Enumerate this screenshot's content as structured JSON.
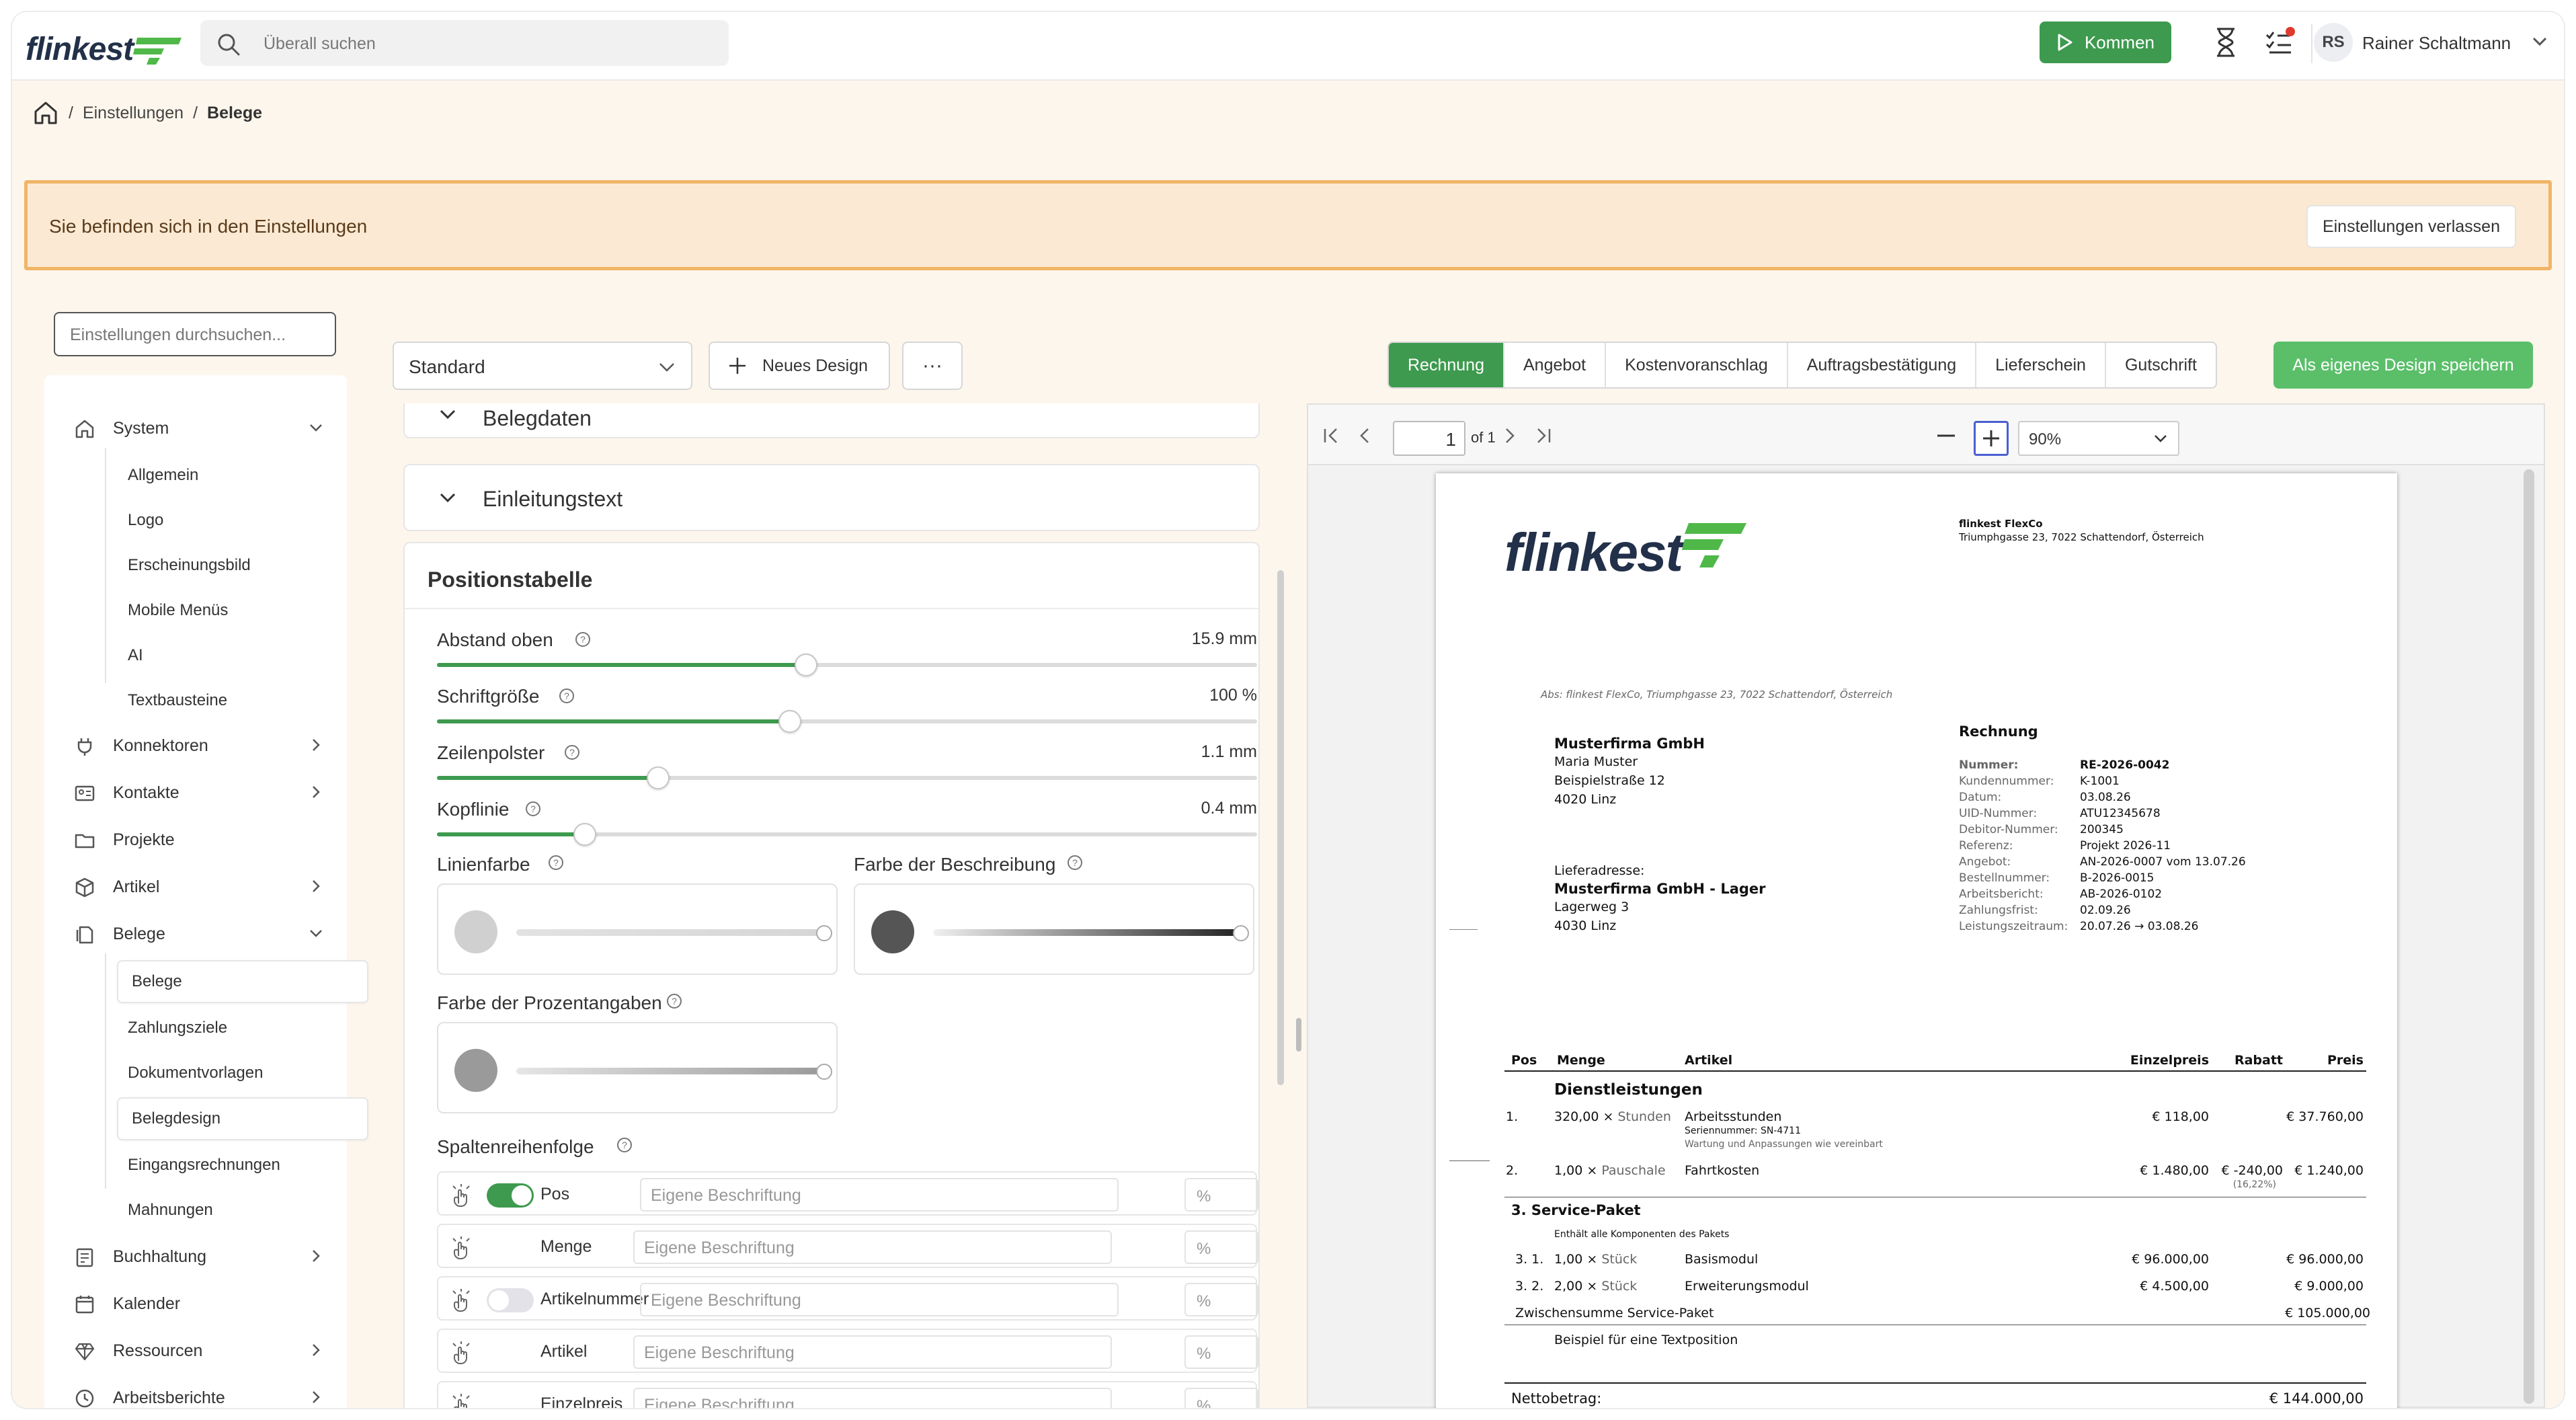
{
  "app": {
    "logo": "flinkest",
    "search_placeholder": "Überall suchen",
    "kommen_label": "Kommen",
    "user_initials": "RS",
    "user_name": "Rainer Schaltmann"
  },
  "breadcrumb": [
    "Einstellungen",
    "Belege"
  ],
  "banner": {
    "text": "Sie befinden sich in den Einstellungen",
    "button": "Einstellungen verlassen"
  },
  "sidebar": {
    "search_placeholder": "Einstellungen durchsuchen...",
    "system": {
      "label": "System",
      "children": [
        "Allgemein",
        "Logo",
        "Erscheinungsbild",
        "Mobile Menüs",
        "AI",
        "Textbausteine"
      ]
    },
    "konnektoren": "Konnektoren",
    "kontakte": "Kontakte",
    "projekte": "Projekte",
    "artikel": "Artikel",
    "belege": {
      "label": "Belege",
      "children": [
        "Belege",
        "Zahlungsziele",
        "Dokumentvorlagen",
        "Belegdesign",
        "Eingangsrechnungen",
        "Mahnungen"
      ]
    },
    "buchhaltung": "Buchhaltung",
    "kalender": "Kalender",
    "ressourcen": "Ressourcen",
    "arbeitsberichte": "Arbeitsberichte"
  },
  "toolbar": {
    "design_select": "Standard",
    "new_design": "Neues Design",
    "more": "···",
    "tabs": [
      "Rechnung",
      "Angebot",
      "Kostenvoranschlag",
      "Auftragsbestätigung",
      "Lieferschein",
      "Gutschrift"
    ],
    "active_tab": "Rechnung",
    "save_label": "Als eigenes Design speichern"
  },
  "settings": {
    "section_belegdaten": "Belegdaten",
    "section_einleitung": "Einleitungstext",
    "section_positionstabelle": "Positionstabelle",
    "sliders": [
      {
        "label": "Abstand oben",
        "value": "15.9 mm",
        "fraction": 0.45
      },
      {
        "label": "Schriftgröße",
        "value": "100 %",
        "fraction": 0.43
      },
      {
        "label": "Zeilenpolster",
        "value": "1.1 mm",
        "fraction": 0.27
      },
      {
        "label": "Kopflinie",
        "value": "0.4 mm",
        "fraction": 0.18
      }
    ],
    "linienfarbe": "Linienfarbe",
    "farbe_beschreibung": "Farbe der Beschreibung",
    "farbe_prozent": "Farbe der Prozentangaben",
    "colors": {
      "linie": "#d0d0d0",
      "beschreibung": "#555555",
      "prozent": "#9a9a9a"
    },
    "spaltenreihenfolge": "Spaltenreihenfolge",
    "columns": [
      {
        "name": "Pos",
        "toggle": "on"
      },
      {
        "name": "Menge",
        "toggle": "none"
      },
      {
        "name": "Artikelnummer",
        "toggle": "off"
      },
      {
        "name": "Artikel",
        "toggle": "none"
      },
      {
        "name": "Einzelpreis",
        "toggle": "none"
      }
    ],
    "column_placeholder": "Eigene Beschriftung",
    "percent_placeholder": "%"
  },
  "preview": {
    "page_number": "1",
    "of_pages": "of 1",
    "zoom": "90%"
  },
  "invoice": {
    "logo": "flinkest",
    "company_name": "flinkest FlexCo",
    "company_address": "Triumphgasse 23, 7022 Schattendorf, Österreich",
    "sender_line": "Abs: flinkest FlexCo, Triumphgasse 23, 7022 Schattendorf, Österreich",
    "recipient": [
      "Musterfirma GmbH",
      "Maria Muster",
      "Beispielstraße 12",
      "4020 Linz"
    ],
    "delivery_label": "Lieferadresse:",
    "delivery": [
      "Musterfirma GmbH - Lager",
      "Lagerweg 3",
      "4030 Linz"
    ],
    "doc_title": "Rechnung",
    "meta_labels": [
      "Nummer:",
      "Kundennummer:",
      "Datum:",
      "UID-Nummer:",
      "Debitor-Nummer:",
      "Referenz:",
      "Angebot:",
      "Bestellnummer:",
      "Arbeitsbericht:",
      "Zahlungsfrist:",
      "Leistungszeitraum:"
    ],
    "meta_values": [
      "RE-2026-0042",
      "K-1001",
      "03.08.26",
      "ATU12345678",
      "200345",
      "Projekt 2026-11",
      "AN-2026-0007 vom 13.07.26",
      "B-2026-0015",
      "AB-2026-0102",
      "02.09.26",
      "20.07.26 → 03.08.26"
    ],
    "table_headers": [
      "Pos",
      "Menge",
      "Artikel",
      "Einzelpreis",
      "Rabatt",
      "Preis"
    ],
    "group1": "Dienstleistungen",
    "row1": {
      "pos": "1.",
      "qty": "320,00 ×",
      "unit": "Stunden",
      "article": "Arbeitsstunden",
      "serial": "Seriennummer: SN-4711",
      "desc": "Wartung und Anpassungen wie vereinbart",
      "price": "€ 118,00",
      "total": "€ 37.760,00"
    },
    "row2": {
      "pos": "2.",
      "qty": "1,00 ×",
      "unit": "Pauschale",
      "article": "Fahrtkosten",
      "price": "€ 1.480,00",
      "discount": "€ -240,00",
      "discount_pct": "(16,22%)",
      "total": "€ 1.240,00"
    },
    "group2": "3. Service-Paket",
    "group2_desc": "Enthält alle Komponenten des Pakets",
    "row31": {
      "pos": "3. 1.",
      "qty": "1,00 ×",
      "unit": "Stück",
      "article": "Basismodul",
      "price": "€ 96.000,00",
      "total": "€ 96.000,00"
    },
    "row32": {
      "pos": "3. 2.",
      "qty": "2,00 ×",
      "unit": "Stück",
      "article": "Erweiterungsmodul",
      "price": "€ 4.500,00",
      "total": "€ 9.000,00"
    },
    "subtotal_label": "Zwischensumme Service-Paket",
    "subtotal_value": "€ 105.000,00",
    "text_position": "Beispiel für eine Textposition",
    "net_label": "Nettobetrag:",
    "net_value": "€ 144.000,00"
  },
  "colors": {
    "accent_green": "#3d9a4e",
    "banner_border": "#f0b566",
    "banner_bg": "#fbe9d3"
  }
}
